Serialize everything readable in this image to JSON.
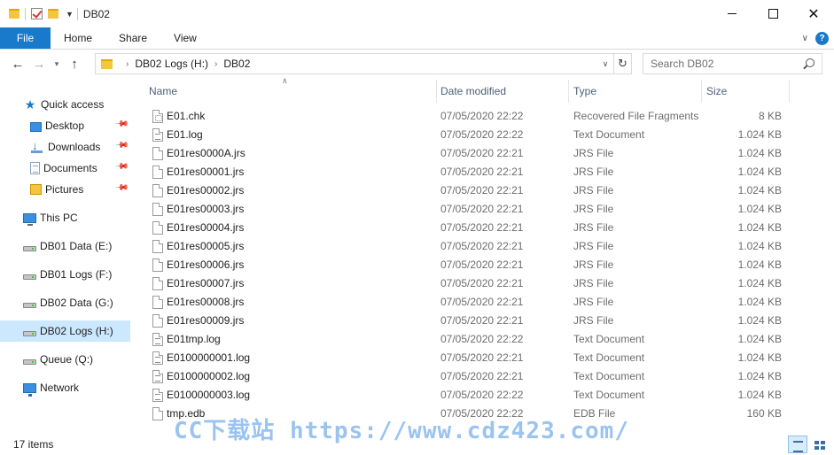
{
  "window": {
    "title": "DB02",
    "controls": {
      "minimize": "",
      "maximize": "",
      "close": "✕"
    }
  },
  "ribbon": {
    "tabs": [
      "File",
      "Home",
      "Share",
      "View"
    ],
    "help": "?"
  },
  "navigation": {
    "back": "←",
    "forward": "→",
    "recent": "▾",
    "up": "↑",
    "breadcrumb": [
      "DB02 Logs (H:)",
      "DB02"
    ],
    "search_placeholder": "Search DB02"
  },
  "sidebar": {
    "items": [
      {
        "label": "Quick access",
        "icon": "star-icon"
      },
      {
        "label": "Desktop",
        "icon": "desktop-icon",
        "pinned": true
      },
      {
        "label": "Downloads",
        "icon": "downloads-icon",
        "pinned": true
      },
      {
        "label": "Documents",
        "icon": "documents-icon",
        "pinned": true
      },
      {
        "label": "Pictures",
        "icon": "pictures-icon",
        "pinned": true
      },
      {
        "label": "This PC",
        "icon": "computer-icon"
      },
      {
        "label": "DB01 Data (E:)",
        "icon": "drive-icon"
      },
      {
        "label": "DB01 Logs (F:)",
        "icon": "drive-icon"
      },
      {
        "label": "DB02 Data (G:)",
        "icon": "drive-icon"
      },
      {
        "label": "DB02 Logs (H:)",
        "icon": "drive-icon",
        "selected": true
      },
      {
        "label": "Queue (Q:)",
        "icon": "drive-icon"
      },
      {
        "label": "Network",
        "icon": "network-icon"
      }
    ]
  },
  "columns": {
    "name": "Name",
    "date": "Date modified",
    "type": "Type",
    "size": "Size"
  },
  "files": [
    {
      "name": "E01.chk",
      "date": "07/05/2020 22:22",
      "type": "Recovered File Fragments",
      "size": "8 KB",
      "icon": "chk-file-icon"
    },
    {
      "name": "E01.log",
      "date": "07/05/2020 22:22",
      "type": "Text Document",
      "size": "1.024 KB",
      "icon": "text-file-icon"
    },
    {
      "name": "E01res0000A.jrs",
      "date": "07/05/2020 22:21",
      "type": "JRS File",
      "size": "1.024 KB",
      "icon": "file-icon"
    },
    {
      "name": "E01res00001.jrs",
      "date": "07/05/2020 22:21",
      "type": "JRS File",
      "size": "1.024 KB",
      "icon": "file-icon"
    },
    {
      "name": "E01res00002.jrs",
      "date": "07/05/2020 22:21",
      "type": "JRS File",
      "size": "1.024 KB",
      "icon": "file-icon"
    },
    {
      "name": "E01res00003.jrs",
      "date": "07/05/2020 22:21",
      "type": "JRS File",
      "size": "1.024 KB",
      "icon": "file-icon"
    },
    {
      "name": "E01res00004.jrs",
      "date": "07/05/2020 22:21",
      "type": "JRS File",
      "size": "1.024 KB",
      "icon": "file-icon"
    },
    {
      "name": "E01res00005.jrs",
      "date": "07/05/2020 22:21",
      "type": "JRS File",
      "size": "1.024 KB",
      "icon": "file-icon"
    },
    {
      "name": "E01res00006.jrs",
      "date": "07/05/2020 22:21",
      "type": "JRS File",
      "size": "1.024 KB",
      "icon": "file-icon"
    },
    {
      "name": "E01res00007.jrs",
      "date": "07/05/2020 22:21",
      "type": "JRS File",
      "size": "1.024 KB",
      "icon": "file-icon"
    },
    {
      "name": "E01res00008.jrs",
      "date": "07/05/2020 22:21",
      "type": "JRS File",
      "size": "1.024 KB",
      "icon": "file-icon"
    },
    {
      "name": "E01res00009.jrs",
      "date": "07/05/2020 22:21",
      "type": "JRS File",
      "size": "1.024 KB",
      "icon": "file-icon"
    },
    {
      "name": "E01tmp.log",
      "date": "07/05/2020 22:22",
      "type": "Text Document",
      "size": "1.024 KB",
      "icon": "text-file-icon"
    },
    {
      "name": "E0100000001.log",
      "date": "07/05/2020 22:21",
      "type": "Text Document",
      "size": "1.024 KB",
      "icon": "text-file-icon"
    },
    {
      "name": "E0100000002.log",
      "date": "07/05/2020 22:21",
      "type": "Text Document",
      "size": "1.024 KB",
      "icon": "text-file-icon"
    },
    {
      "name": "E0100000003.log",
      "date": "07/05/2020 22:22",
      "type": "Text Document",
      "size": "1.024 KB",
      "icon": "text-file-icon"
    },
    {
      "name": "tmp.edb",
      "date": "07/05/2020 22:22",
      "type": "EDB File",
      "size": "160 KB",
      "icon": "file-icon"
    }
  ],
  "status": {
    "item_count": "17 items"
  },
  "watermark": "CC下载站 https://www.cdz423.com/",
  "colors": {
    "accent": "#1979ca",
    "selected": "#cce8ff",
    "header_text": "#4c607a"
  }
}
